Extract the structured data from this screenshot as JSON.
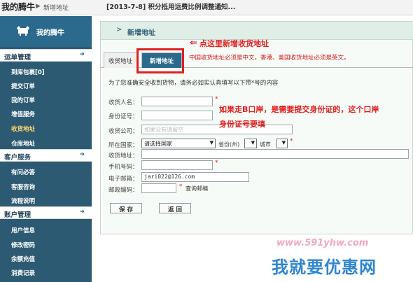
{
  "top": {
    "site_title": "我的腾牛",
    "crumb_sep": "▶",
    "breadcrumb": "新增地址",
    "notice": "[2013-7-8] 积分抵用运费比例调整通知..."
  },
  "sidebar": {
    "logo_text": "我的腾牛",
    "sections": [
      {
        "label": "运单管理",
        "items": [
          "到库包裹[0]",
          "提交订单",
          "我的订单",
          "增值服务",
          "收货地址",
          "仓库地址"
        ]
      },
      {
        "label": "客户服务",
        "items": [
          "有问必答",
          "客服咨询",
          "流程说明"
        ]
      },
      {
        "label": "账户管理",
        "items": [
          "用户信息",
          "修改密码",
          "余额充值",
          "消费记录"
        ]
      }
    ],
    "active_item": "收货地址",
    "arrow": "➜"
  },
  "main": {
    "title_chevron": ">",
    "title": "新增地址",
    "tabs": [
      {
        "label": "收货地址",
        "selected": false
      },
      {
        "label": "新增地址",
        "selected": true
      }
    ],
    "annotation_arrow": "⇐",
    "annotation_tab": "点这里新增收货地址",
    "hint_red": "中国收货地址必须是中文，香港、美国收货地址必须是英文。",
    "intro": "为了您准确安全收到货物，请务必如实认真填写以下带*号的内容",
    "required_mark": "*",
    "form": {
      "receiver_label": "收货人名：",
      "receiver_value": "",
      "id_label": "身份证号：",
      "id_value": "",
      "company_label": "收货公司：",
      "company_placeholder": "如果没有请留空",
      "country_label": "所在国家：",
      "country_value": "请选择国家",
      "province_label": "省份(州)",
      "city_label": "城市",
      "address_label": "收货地址：",
      "mobile_label": "手机号码：",
      "email_label": "电子邮箱：",
      "email_value": "jari022@126.com",
      "postcode_label": "邮政编码：",
      "postcode_lookup": "查询邮编"
    },
    "annotation_id_line1": "如果走B口岸，是需要提交身份证的，这个口岸",
    "annotation_id_line2": "身份证号要填",
    "buttons": {
      "save": "保 存",
      "back": "返 回"
    }
  },
  "watermark": {
    "url": "www.591yhw.com",
    "text": "我就要优惠网"
  },
  "colors": {
    "sidebar_bg": "#2d5a73",
    "tab_active": "#2b6a8c",
    "annotation_red": "#e02020",
    "watermark_blue": "#2f86d0"
  }
}
